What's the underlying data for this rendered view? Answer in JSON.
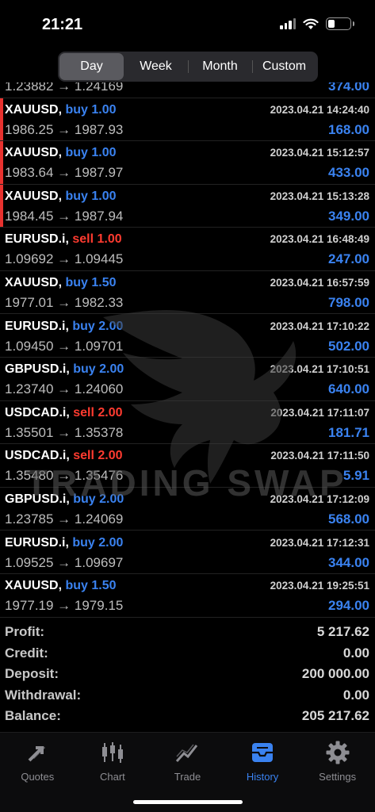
{
  "status_bar": {
    "time": "21:21"
  },
  "period_tabs": [
    {
      "label": "Day",
      "active": true
    },
    {
      "label": "Week",
      "active": false
    },
    {
      "label": "Month",
      "active": false
    },
    {
      "label": "Custom",
      "active": false
    }
  ],
  "partial_row": {
    "prices": "1.23882 → 1.24169",
    "profit": "374.00"
  },
  "deals": [
    {
      "symbol": "XAUUSD,",
      "type": "buy",
      "volume": "1.00",
      "time": "2023.04.21 14:24:40",
      "prices": "1986.25 → 1987.93",
      "profit": "168.00",
      "flagged": true
    },
    {
      "symbol": "XAUUSD,",
      "type": "buy",
      "volume": "1.00",
      "time": "2023.04.21 15:12:57",
      "prices": "1983.64 → 1987.97",
      "profit": "433.00",
      "flagged": true
    },
    {
      "symbol": "XAUUSD,",
      "type": "buy",
      "volume": "1.00",
      "time": "2023.04.21 15:13:28",
      "prices": "1984.45 → 1987.94",
      "profit": "349.00",
      "flagged": true
    },
    {
      "symbol": "EURUSD.i,",
      "type": "sell",
      "volume": "1.00",
      "time": "2023.04.21 16:48:49",
      "prices": "1.09692 → 1.09445",
      "profit": "247.00",
      "flagged": false
    },
    {
      "symbol": "XAUUSD,",
      "type": "buy",
      "volume": "1.50",
      "time": "2023.04.21 16:57:59",
      "prices": "1977.01 → 1982.33",
      "profit": "798.00",
      "flagged": false
    },
    {
      "symbol": "EURUSD.i,",
      "type": "buy",
      "volume": "2.00",
      "time": "2023.04.21 17:10:22",
      "prices": "1.09450 → 1.09701",
      "profit": "502.00",
      "flagged": false
    },
    {
      "symbol": "GBPUSD.i,",
      "type": "buy",
      "volume": "2.00",
      "time": "2023.04.21 17:10:51",
      "prices": "1.23740 → 1.24060",
      "profit": "640.00",
      "flagged": false
    },
    {
      "symbol": "USDCAD.i,",
      "type": "sell",
      "volume": "2.00",
      "time": "2023.04.21 17:11:07",
      "prices": "1.35501 → 1.35378",
      "profit": "181.71",
      "flagged": false
    },
    {
      "symbol": "USDCAD.i,",
      "type": "sell",
      "volume": "2.00",
      "time": "2023.04.21 17:11:50",
      "prices": "1.35480 → 1.35476",
      "profit": "5.91",
      "flagged": false
    },
    {
      "symbol": "GBPUSD.i,",
      "type": "buy",
      "volume": "2.00",
      "time": "2023.04.21 17:12:09",
      "prices": "1.23785 → 1.24069",
      "profit": "568.00",
      "flagged": false
    },
    {
      "symbol": "EURUSD.i,",
      "type": "buy",
      "volume": "2.00",
      "time": "2023.04.21 17:12:31",
      "prices": "1.09525 → 1.09697",
      "profit": "344.00",
      "flagged": false
    },
    {
      "symbol": "XAUUSD,",
      "type": "buy",
      "volume": "1.50",
      "time": "2023.04.21 19:25:51",
      "prices": "1977.19 → 1979.15",
      "profit": "294.00",
      "flagged": false
    }
  ],
  "summary": [
    {
      "label": "Profit:",
      "value": "5 217.62"
    },
    {
      "label": "Credit:",
      "value": "0.00"
    },
    {
      "label": "Deposit:",
      "value": "200 000.00"
    },
    {
      "label": "Withdrawal:",
      "value": "0.00"
    },
    {
      "label": "Balance:",
      "value": "205 217.62"
    }
  ],
  "tabbar": [
    {
      "label": "Quotes",
      "icon": "quotes-arrows-icon",
      "active": false
    },
    {
      "label": "Chart",
      "icon": "candlestick-icon",
      "active": false
    },
    {
      "label": "Trade",
      "icon": "trade-line-icon",
      "active": false
    },
    {
      "label": "History",
      "icon": "history-tray-icon",
      "active": true
    },
    {
      "label": "Settings",
      "icon": "gear-icon",
      "active": false
    }
  ],
  "watermark": {
    "text": "TRADING SWAP"
  },
  "colors": {
    "buy": "#3a82f0",
    "sell": "#ff3b30",
    "flag": "#e8322f",
    "active_tab": "#3a82f0"
  }
}
